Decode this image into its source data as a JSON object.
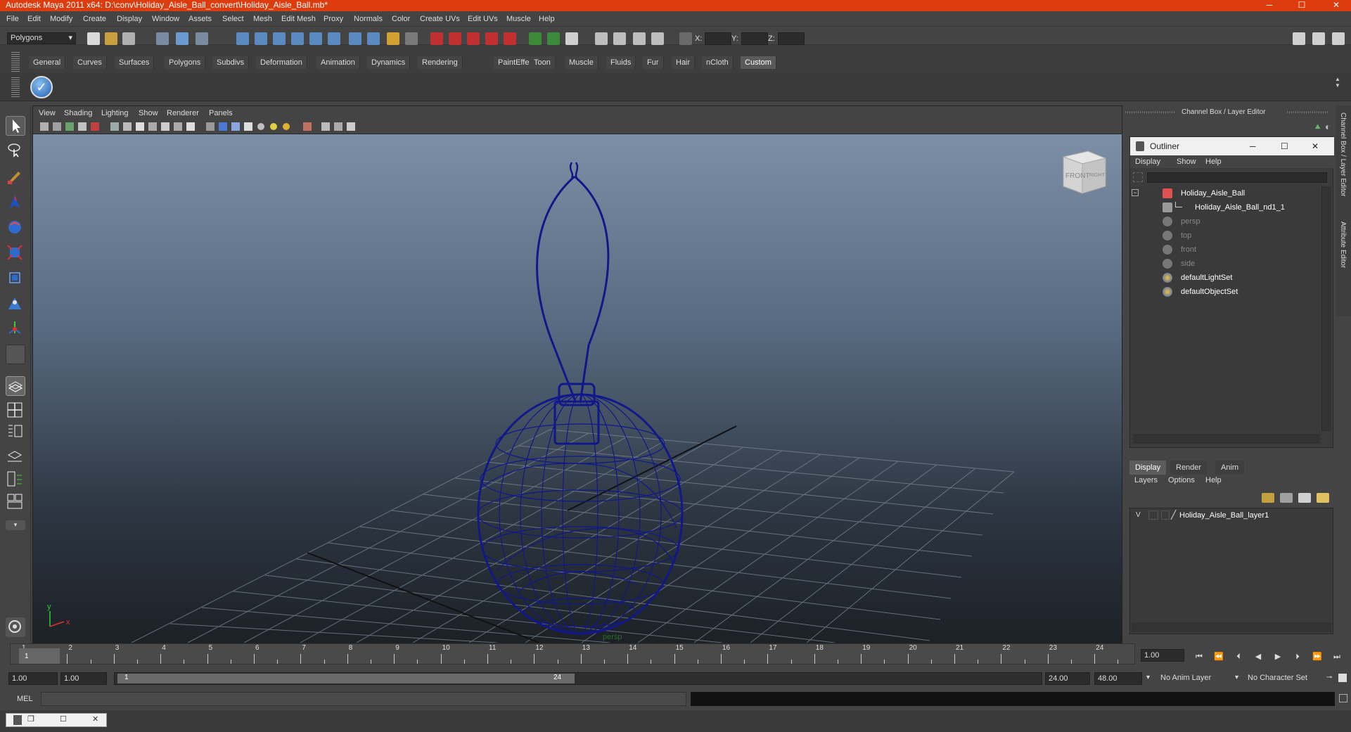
{
  "window": {
    "title": "Autodesk Maya 2011 x64: D:\\conv\\Holiday_Aisle_Ball_convert\\Holiday_Aisle_Ball.mb*",
    "minimize": "─",
    "maximize": "☐",
    "close": "✕"
  },
  "menubar": [
    "File",
    "Edit",
    "Modify",
    "Create",
    "Display",
    "Window",
    "Assets",
    "Select",
    "Mesh",
    "Edit Mesh",
    "Proxy",
    "Normals",
    "Color",
    "Create UVs",
    "Edit UVs",
    "Muscle",
    "Help"
  ],
  "statusline": {
    "mode": "Polygons",
    "x_label": "X:",
    "y_label": "Y:",
    "z_label": "Z:"
  },
  "shelf_tabs": [
    "General",
    "Curves",
    "Surfaces",
    "Polygons",
    "Subdivs",
    "Deformation",
    "Animation",
    "Dynamics",
    "Rendering",
    "PaintEffects",
    "Toon",
    "Muscle",
    "Fluids",
    "Fur",
    "Hair",
    "nCloth",
    "Custom"
  ],
  "shelf_active": "Custom",
  "panel_menu": [
    "View",
    "Shading",
    "Lighting",
    "Show",
    "Renderer",
    "Panels"
  ],
  "viewport": {
    "camera_label": "persp",
    "viewcube_front": "FRONT",
    "viewcube_right": "RIGHT",
    "axis_y": "y",
    "axis_x": "x"
  },
  "channel_box": {
    "title": "Channel Box / Layer Editor"
  },
  "outliner": {
    "title": "Outliner",
    "menu": [
      "Display",
      "Show",
      "Help"
    ],
    "items": [
      {
        "label": "Holiday_Aisle_Ball",
        "color": "#ffffff",
        "indent": 0
      },
      {
        "label": "Holiday_Aisle_Ball_nd1_1",
        "color": "#ffffff",
        "indent": 1
      },
      {
        "label": "persp",
        "color": "#888888",
        "indent": 0
      },
      {
        "label": "top",
        "color": "#888888",
        "indent": 0
      },
      {
        "label": "front",
        "color": "#888888",
        "indent": 0
      },
      {
        "label": "side",
        "color": "#888888",
        "indent": 0
      },
      {
        "label": "defaultLightSet",
        "color": "#ffffff",
        "indent": 0
      },
      {
        "label": "defaultObjectSet",
        "color": "#ffffff",
        "indent": 0
      }
    ]
  },
  "layer_editor": {
    "tabs": [
      "Display",
      "Render",
      "Anim"
    ],
    "active_tab": "Display",
    "menu": [
      "Layers",
      "Options",
      "Help"
    ],
    "layer_visible": "V",
    "layer_name": "Holiday_Aisle_Ball_layer1"
  },
  "side_tabs": [
    "Channel Box / Layer Editor",
    "Attribute Editor"
  ],
  "timeslider": {
    "ticks": [
      "1",
      "2",
      "3",
      "4",
      "5",
      "6",
      "7",
      "8",
      "9",
      "10",
      "11",
      "12",
      "13",
      "14",
      "15",
      "16",
      "17",
      "18",
      "19",
      "20",
      "21",
      "22",
      "23",
      "24"
    ],
    "current_frame_marker": "1",
    "current_time": "1.00"
  },
  "range": {
    "start_time": "1.00",
    "playback_start": "1.00",
    "range_start_label": "1",
    "range_end_label": "24",
    "playback_end": "24.00",
    "end_time": "48.00",
    "anim_layer": "No Anim Layer",
    "character_set": "No Character Set"
  },
  "cmdline": {
    "label": "MEL"
  },
  "colors": {
    "title_bar": "#dd3c0e",
    "wireframe": "#10188a"
  }
}
